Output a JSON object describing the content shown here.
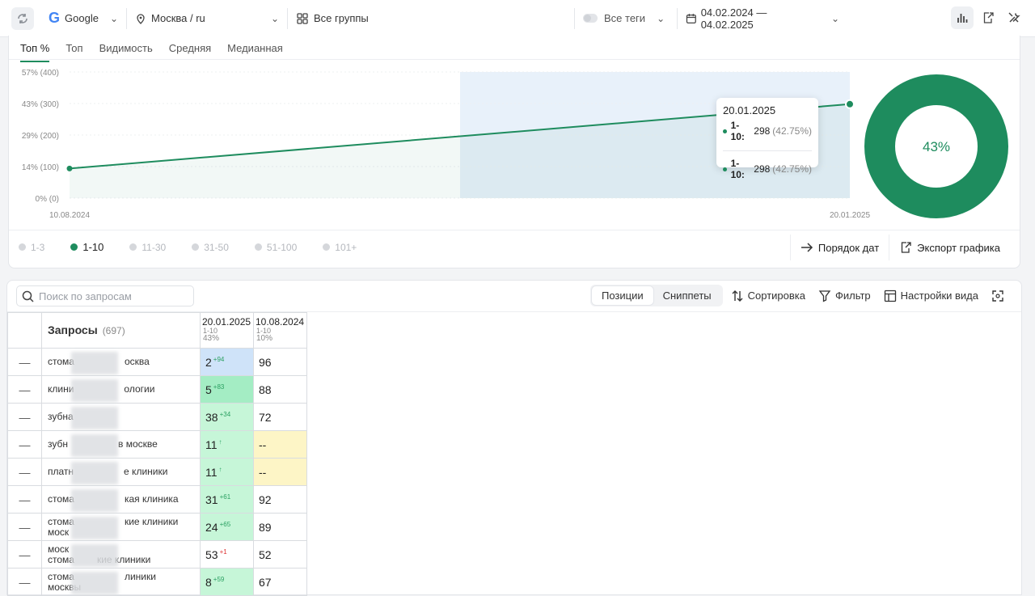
{
  "toolbar": {
    "search_engine": "Google",
    "region": "Москва / ru",
    "groups": "Все группы",
    "tags": "Все теги",
    "date_range": "04.02.2024 — 04.02.2025"
  },
  "chart_tabs": [
    "Топ %",
    "Топ",
    "Видимость",
    "Средняя",
    "Медианная"
  ],
  "chart_data": {
    "type": "line",
    "y_tick_labels": [
      "57% (400)",
      "43% (300)",
      "29% (200)",
      "14% (100)",
      "0% (0)"
    ],
    "ylim": [
      0,
      400
    ],
    "x": [
      "10.08.2024",
      "20.01.2025"
    ],
    "series": [
      {
        "name": "1-10",
        "values": [
          94,
          298
        ]
      }
    ],
    "highlighted_range": [
      "20.01.2025"
    ],
    "grid": true
  },
  "tooltip": {
    "date": "20.01.2025",
    "rows": [
      {
        "label": "1-10:",
        "value": "298",
        "pct": "(42.75%)"
      },
      {
        "label": "1-10:",
        "value": "298",
        "pct": "(42.75%)"
      }
    ]
  },
  "donut": {
    "label": "43%",
    "percent": 43,
    "color": "#1e8c5e"
  },
  "legend": [
    {
      "label": "1-3",
      "active": false
    },
    {
      "label": "1-10",
      "active": true
    },
    {
      "label": "11-30",
      "active": false
    },
    {
      "label": "31-50",
      "active": false
    },
    {
      "label": "51-100",
      "active": false
    },
    {
      "label": "101+",
      "active": false
    }
  ],
  "chart_actions": {
    "date_order": "Порядок дат",
    "export": "Экспорт графика"
  },
  "table_toolbar": {
    "search_placeholder": "Поиск по запросам",
    "positions": "Позиции",
    "snippets": "Сниппеты",
    "sort": "Сортировка",
    "filter": "Фильтр",
    "view_settings": "Настройки вида"
  },
  "table": {
    "header": {
      "queries": "Запросы",
      "count": "(697)"
    },
    "date_columns": [
      {
        "date": "20.01.2025",
        "range": "1-10",
        "pct": "43%"
      },
      {
        "date": "10.08.2024",
        "range": "1-10",
        "pct": "10%"
      }
    ],
    "rows": [
      {
        "toggle": "—",
        "q1": "стома",
        "q2": "осква",
        "v1": "2",
        "d1": "+94",
        "v2": "96",
        "c1": "bg-blue",
        "c2": ""
      },
      {
        "toggle": "—",
        "q1": "клини",
        "q2": "ологии",
        "v1": "5",
        "d1": "+83",
        "v2": "88",
        "c1": "bg-green",
        "c2": ""
      },
      {
        "toggle": "—",
        "q1": "зубна",
        "q2": "",
        "v1": "38",
        "d1": "+34",
        "v2": "72",
        "c1": "bg-lgreen",
        "c2": ""
      },
      {
        "toggle": "—",
        "q1": "зубн",
        "q2": "в москве",
        "v1": "11",
        "d1": "↑",
        "v2": "--",
        "c1": "bg-lgreen",
        "c2": "bg-yellow"
      },
      {
        "toggle": "—",
        "q1": "платн",
        "q2": "е клиники",
        "v1": "11",
        "d1": "↑",
        "v2": "--",
        "c1": "bg-lgreen",
        "c2": "bg-yellow"
      },
      {
        "toggle": "—",
        "q1": "стома",
        "q2": "кая клиника",
        "v1": "31",
        "d1": "+61",
        "v2": "92",
        "c1": "bg-lgreen",
        "c2": ""
      },
      {
        "toggle": "—",
        "q1": "стома",
        "q2": "кие клиники",
        "q3": "моск",
        "v1": "24",
        "d1": "+65",
        "v2": "89",
        "c1": "bg-lgreen",
        "c2": ""
      },
      {
        "toggle": "—",
        "q1": "моск",
        "q2": "",
        "q3": "стома",
        "q4": "кие клиники",
        "v1": "53",
        "d1": "+1",
        "v2": "52",
        "c1": "",
        "c2": "",
        "neg": true
      },
      {
        "toggle": "—",
        "q1": "стома",
        "q2": "линики",
        "q3": "москвы",
        "v1": "8",
        "d1": "+59",
        "v2": "67",
        "c1": "bg-lgreen",
        "c2": ""
      }
    ]
  }
}
